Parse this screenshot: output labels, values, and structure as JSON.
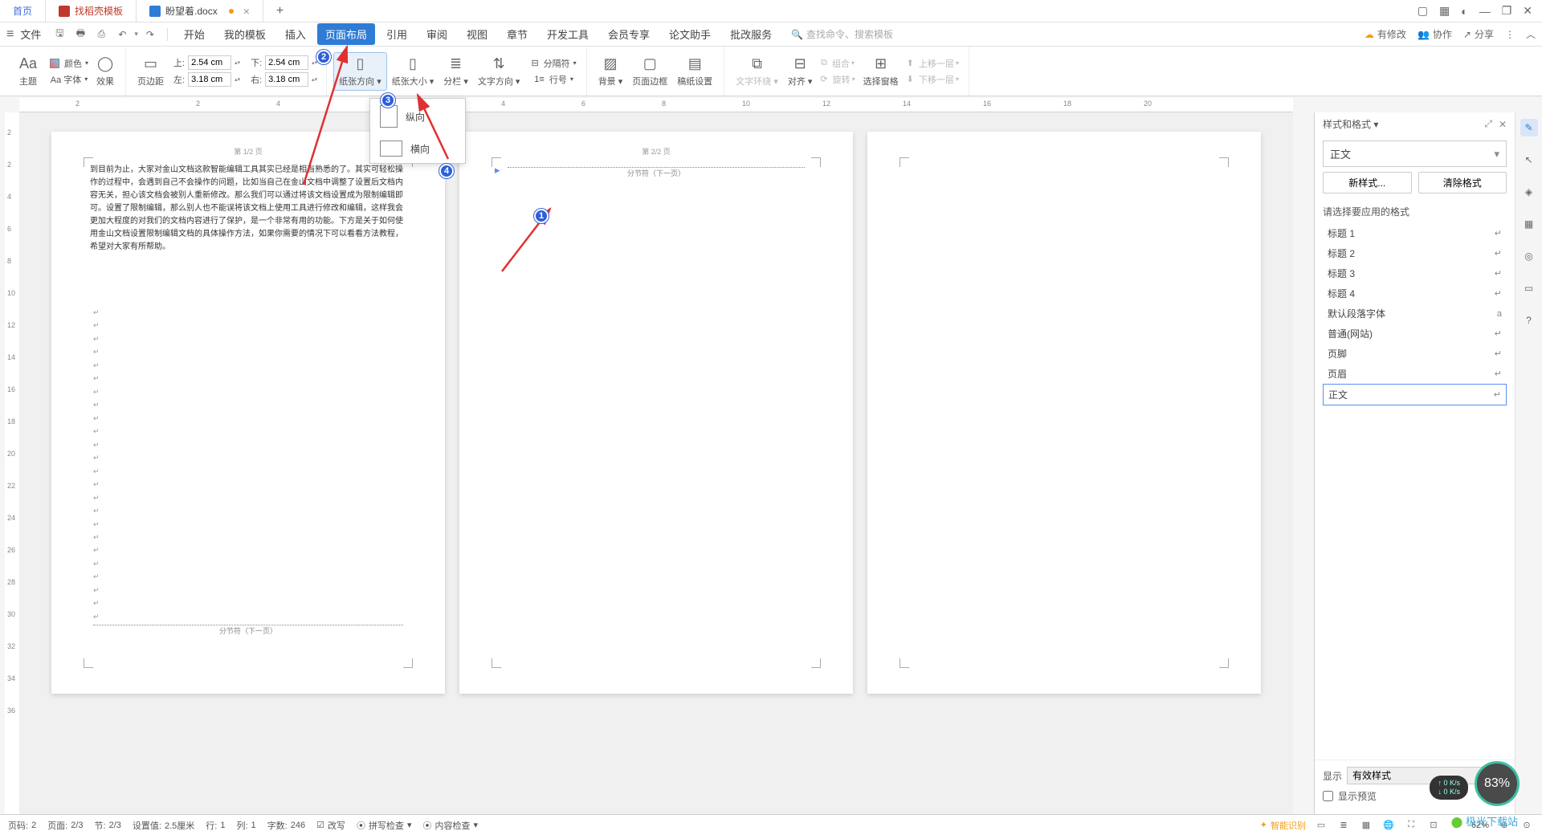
{
  "titlebar": {
    "tabs": {
      "home": "首页",
      "template": "找稻壳模板",
      "doc": "盼望着.docx",
      "plus": "+"
    },
    "window": {
      "grid1": "▢",
      "grid2": "▦",
      "user": "◐",
      "min": "—",
      "max": "❐",
      "close": "✕"
    }
  },
  "menurow": {
    "file": "文件",
    "tools": {
      "save": "🖫",
      "print": "🖶",
      "preview": "⎙",
      "undo": "↶",
      "redo": "↷"
    },
    "menus": [
      "开始",
      "我的模板",
      "插入",
      "页面布局",
      "引用",
      "审阅",
      "视图",
      "章节",
      "开发工具",
      "会员专享",
      "论文助手",
      "批改服务"
    ],
    "search_placeholder": "查找命令、搜索模板",
    "right": {
      "changes": "有修改",
      "coop": "协作",
      "share": "分享"
    }
  },
  "ribbon": {
    "theme": {
      "theme": "主题",
      "font": "Aa 字体",
      "effect": "效果"
    },
    "margins": {
      "label": "页边距",
      "top_l": "上:",
      "top_v": "2.54 cm",
      "bot_l": "下:",
      "bot_v": "2.54 cm",
      "left_l": "左:",
      "left_v": "3.18 cm",
      "right_l": "右:",
      "right_v": "3.18 cm"
    },
    "orient": "纸张方向",
    "size": "纸张大小",
    "columns": "分栏",
    "textdir": "文字方向",
    "lineno": "行号",
    "hyphen": "分隔符",
    "bg": "背景",
    "border": "页面边框",
    "paper": "稿纸设置",
    "wrap": "文字环绕",
    "align": "对齐",
    "rotate": "旋转",
    "combine": "组合",
    "selpane": "选择窗格",
    "up": "上移一层",
    "down": "下移一层",
    "orient_menu": {
      "portrait": "纵向",
      "landscape": "横向"
    }
  },
  "pages": {
    "p1_header": "第 1/2 页",
    "p1_text": "到目前为止，大家对金山文档这款智能编辑工具其实已经是相当熟悉的了。其实可轻松操作的过程中，会遇到自己不会操作的问题，比如当自己在金山文档中调整了设置后文档内容无关，担心该文档会被别人重新修改。那么我们可以通过将该文档设置成为限制编辑即可。设置了限制编辑，那么别人也不能误将该文档上使用工具进行修改和编辑，这样我会更加大程度的对我们的文档内容进行了保护，是一个非常有用的功能。下方是关于如何使用金山文档设置限制编辑文档的具体操作方法，如果你需要的情况下可以看看方法教程，希望对大家有所帮助。",
    "p2_header": "第 2/2 页",
    "p2_break": "分节符（下一页）",
    "p3_header": ""
  },
  "annot": {
    "m1": "1",
    "m2": "2",
    "m3": "3",
    "m4": "4"
  },
  "styles": {
    "title": "样式和格式",
    "current": "正文",
    "new": "新样式...",
    "clear": "清除格式",
    "select_label": "请选择要应用的格式",
    "items": [
      "标题 1",
      "标题 2",
      "标题 3",
      "标题 4",
      "默认段落字体",
      "普通(网站)",
      "页脚",
      "页眉",
      "正文"
    ],
    "show_label": "显示",
    "show_value": "有效样式",
    "preview": "显示预览"
  },
  "status": {
    "pages_l": "页码:",
    "pages_v": "2",
    "page_l": "页面:",
    "page_v": "2/3",
    "sec_l": "节:",
    "sec_v": "2/3",
    "set_l": "设置值:",
    "set_v": "2.5厘米",
    "row_l": "行:",
    "row_v": "1",
    "col_l": "列:",
    "col_v": "1",
    "words_l": "字数:",
    "words_v": "246",
    "rewrite": "改写",
    "spell": "拼写检查",
    "content": "内容检查",
    "zoom": "62%",
    "smart": "智能识别"
  },
  "float": {
    "percent": "83%",
    "net_up": "0 K/s",
    "net_dn": "0 K/s"
  },
  "wm": "极光下载站"
}
